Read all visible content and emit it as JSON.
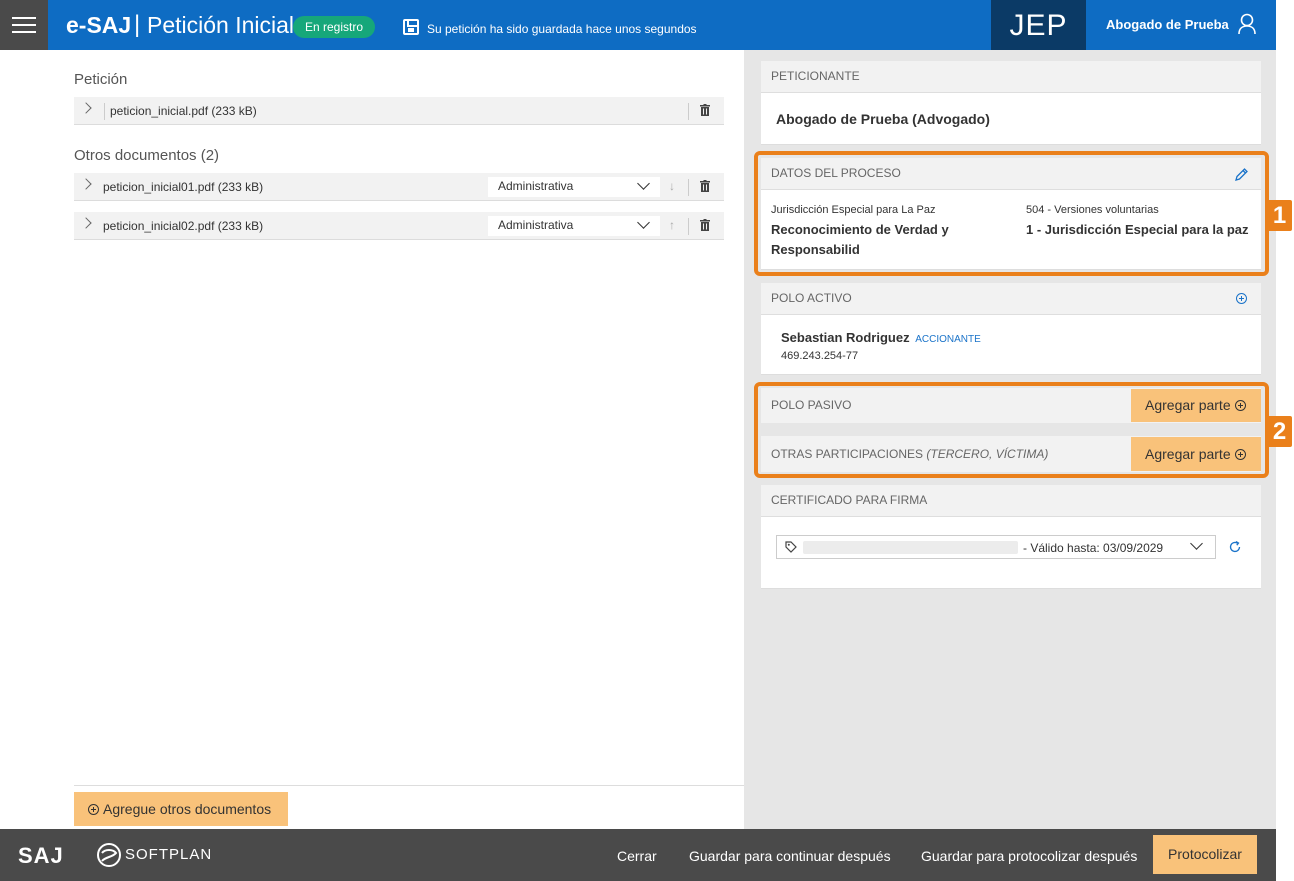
{
  "header": {
    "brand": "e-SAJ",
    "separator": "|",
    "title": "Petición Inicial",
    "status_badge": "En registro",
    "save_message": "Su petición ha sido guardada hace unos segundos",
    "org": "JEP",
    "user_name": "Abogado de Prueba"
  },
  "left": {
    "peticion_title": "Petición",
    "peticion_file": "peticion_inicial.pdf (233 kB)",
    "otros_title": "Otros documentos (2)",
    "otros_docs": [
      {
        "name": "peticion_inicial01.pdf (233 kB)",
        "type": "Administrativa",
        "arrow": "↓"
      },
      {
        "name": "peticion_inicial02.pdf (233 kB)",
        "type": "Administrativa",
        "arrow": "↑"
      }
    ],
    "add_docs_label": "Agregue otros documentos"
  },
  "right": {
    "peticionante": {
      "header": "PETICIONANTE",
      "value": "Abogado de Prueba (Advogado)"
    },
    "datos_proceso": {
      "header": "DATOS DEL PROCESO",
      "col1_small": "Jurisdicción Especial para La Paz",
      "col1_main": "Reconocimiento de Verdad y Responsabilid",
      "col2_small": "504 - Versiones voluntarias",
      "col2_main": "1 - Jurisdicción Especial para la paz"
    },
    "polo_activo": {
      "header": "POLO ACTIVO",
      "person_name": "Sebastian Rodriguez",
      "person_role": "ACCIONANTE",
      "person_id": "469.243.254-77"
    },
    "polo_pasivo": {
      "header": "POLO PASIVO",
      "button": "Agregar parte"
    },
    "otras_participaciones": {
      "header": "OTRAS PARTICIPACIONES",
      "hint": "(TERCERO, VÍCTIMA)",
      "button": "Agregar parte"
    },
    "certificado": {
      "header": "CERTIFICADO PARA FIRMA",
      "validity": "- Válido hasta: 03/09/2029"
    },
    "highlight_labels": [
      "1",
      "2"
    ]
  },
  "footer": {
    "saj_logo": "SAJ",
    "softplan_logo": "SOFTPLAN",
    "cerrar": "Cerrar",
    "guardar_continuar": "Guardar para continuar después",
    "guardar_protocolizar": "Guardar para protocolizar después",
    "protocolizar": "Protocolizar"
  },
  "colors": {
    "header_blue": "#0e6cc3",
    "org_navy": "#0b3a66",
    "badge_green": "#16a77a",
    "accent_orange": "#f9c27a",
    "highlight_orange": "#ea801b",
    "footer_gray": "#4a4a4a",
    "link_blue": "#1a73c9"
  }
}
